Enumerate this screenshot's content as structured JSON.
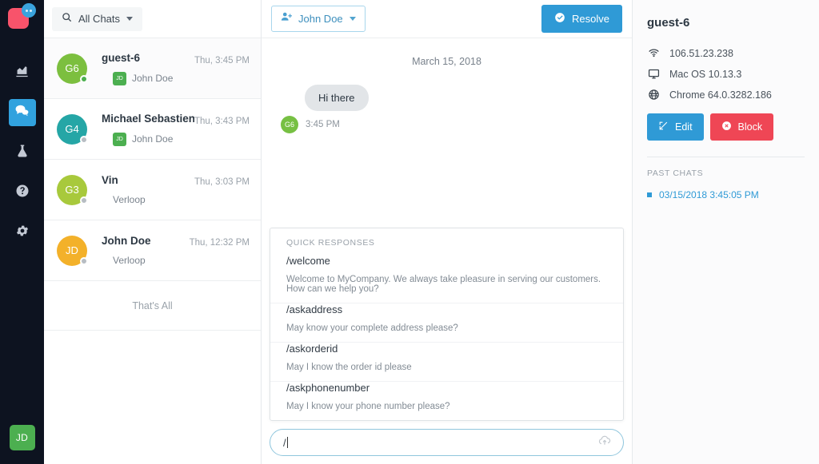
{
  "rail": {
    "logo_name": "verloop-logo",
    "items": [
      {
        "name": "analytics",
        "icon": "chart-icon",
        "active": false
      },
      {
        "name": "chats",
        "icon": "chat-icon",
        "active": true
      },
      {
        "name": "lab",
        "icon": "flask-icon",
        "active": false
      },
      {
        "name": "help",
        "icon": "question-circle-icon",
        "active": false
      },
      {
        "name": "settings",
        "icon": "gear-icon",
        "active": false
      }
    ],
    "avatar_initials": "JD"
  },
  "chat_list": {
    "filter_label": "All Chats",
    "search_icon": "search-icon",
    "footer_label": "That's All",
    "rows": [
      {
        "initials": "G6",
        "avatar_color": "#7cbf3f",
        "status_color": "#4caf50",
        "name": "guest-6",
        "time": "Thu, 3:45 PM",
        "agent_badge": "JD",
        "agent_badge_color": "#4caf50",
        "agent": "John Doe",
        "selected": true
      },
      {
        "initials": "G4",
        "avatar_color": "#25a6a6",
        "status_color": "#b7bdc3",
        "name": "Michael Sebastien",
        "time": "Thu, 3:43 PM",
        "agent_badge": "JD",
        "agent_badge_color": "#4caf50",
        "agent": "John Doe",
        "selected": false
      },
      {
        "initials": "G3",
        "avatar_color": "#a8c93c",
        "status_color": "#b7bdc3",
        "name": "Vin",
        "time": "Thu, 3:03 PM",
        "agent_badge": "",
        "agent_badge_color": "",
        "agent": "Verloop",
        "selected": false
      },
      {
        "initials": "JD",
        "avatar_color": "#f3b12a",
        "status_color": "#b7bdc3",
        "name": "John Doe",
        "time": "Thu, 12:32 PM",
        "agent_badge": "",
        "agent_badge_color": "",
        "agent": "Verloop",
        "selected": false
      }
    ]
  },
  "conversation": {
    "assign_label": "John Doe",
    "assign_icon": "user-add-icon",
    "resolve_label": "Resolve",
    "resolve_icon": "check-circle-icon",
    "date_separator": "March 15, 2018",
    "messages": [
      {
        "text": "Hi there",
        "time": "3:45 PM",
        "initials": "G6",
        "avatar_color": "#77c043"
      }
    ],
    "quick_responses": {
      "title": "QUICK RESPONSES",
      "items": [
        {
          "command": "/welcome",
          "text": "Welcome to MyCompany. We always take pleasure in serving our customers. How can we help you?"
        },
        {
          "command": "/askaddress",
          "text": "May know your complete address please?"
        },
        {
          "command": "/askorderid",
          "text": "May I know the order id please"
        },
        {
          "command": "/askphonenumber",
          "text": "May I know your phone number please?"
        }
      ]
    },
    "composer": {
      "value": "/",
      "placeholder": "",
      "upload_icon": "cloud-upload-icon"
    }
  },
  "panel": {
    "title": "guest-6",
    "meta": [
      {
        "icon": "wifi-icon",
        "value": "106.51.23.238"
      },
      {
        "icon": "monitor-icon",
        "value": "Mac OS 10.13.3"
      },
      {
        "icon": "globe-icon",
        "value": "Chrome 64.0.3282.186"
      }
    ],
    "edit_label": "Edit",
    "edit_icon": "pencil-square-icon",
    "block_label": "Block",
    "block_icon": "x-circle-icon",
    "past_chats_title": "PAST CHATS",
    "past_chats": [
      {
        "label": "03/15/2018 3:45:05 PM"
      }
    ]
  },
  "colors": {
    "accent_blue": "#2f9ad6",
    "danger_red": "#ef4655",
    "rail_bg": "#0d1320",
    "green": "#4caf50"
  }
}
